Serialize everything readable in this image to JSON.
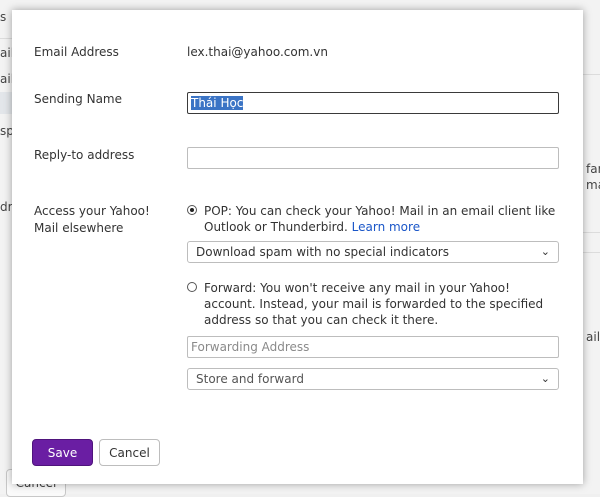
{
  "background": {
    "fragments": [
      "s",
      "ail",
      "ail",
      "spe",
      "dre",
      "fam",
      "mai",
      "ails."
    ],
    "cancel_label": "Cancel"
  },
  "form": {
    "email_label": "Email Address",
    "email_value": "lex.thai@yahoo.com.vn",
    "sending_name_label": "Sending Name",
    "sending_name_value": "Thái Học",
    "reply_to_label": "Reply-to address",
    "reply_to_value": "",
    "access_label_line1": "Access your Yahoo!",
    "access_label_line2": "Mail elsewhere",
    "pop_option": {
      "selected": true,
      "text": "POP: You can check your Yahoo! Mail in an email client like Outlook or Thunderbird.",
      "link": "Learn more"
    },
    "spam_dropdown": {
      "selected": "Download spam with no special indicators"
    },
    "forward_option": {
      "selected": false,
      "text": "Forward: You won't receive any mail in your Yahoo! account. Instead, your mail is forwarded to the specified address so that you can check it there."
    },
    "forwarding_address_placeholder": "Forwarding Address",
    "forward_dropdown": {
      "selected": "Store and forward"
    }
  },
  "buttons": {
    "save": "Save",
    "cancel": "Cancel"
  },
  "colors": {
    "save_button": "#6a1ea3",
    "link": "#1a56c8",
    "selection": "#3b74c5"
  }
}
